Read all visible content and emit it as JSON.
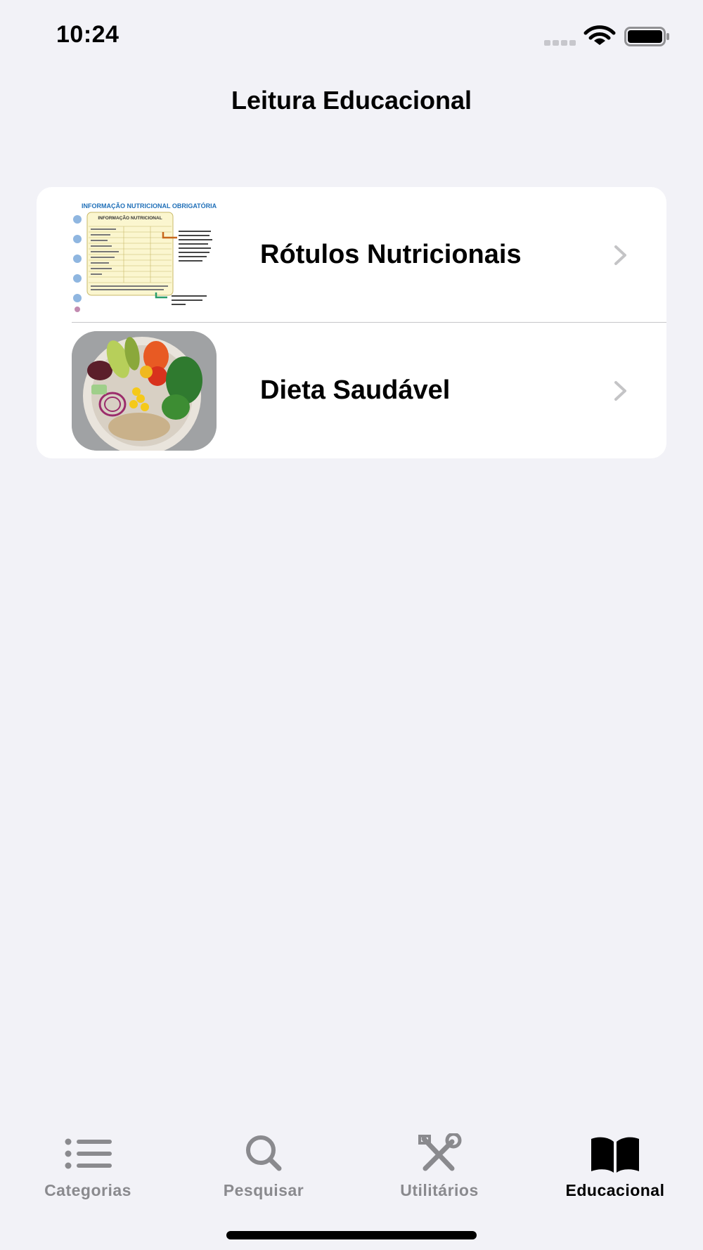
{
  "status_bar": {
    "time": "10:24"
  },
  "nav": {
    "title": "Leitura Educacional"
  },
  "list": {
    "items": [
      {
        "label": "Rótulos Nutricionais",
        "thumb_caption": "INFORMAÇÃO NUTRICIONAL OBRIGATÓRIA",
        "thumb_table_title": "INFORMAÇÃO NUTRICIONAL"
      },
      {
        "label": "Dieta Saudável"
      }
    ]
  },
  "tabs": [
    {
      "label": "Categorias",
      "icon": "list-icon",
      "active": false
    },
    {
      "label": "Pesquisar",
      "icon": "search-icon",
      "active": false
    },
    {
      "label": "Utilitários",
      "icon": "tools-icon",
      "active": false
    },
    {
      "label": "Educacional",
      "icon": "book-icon",
      "active": true
    }
  ],
  "colors": {
    "background": "#f2f2f7",
    "card": "#ffffff",
    "inactive_tab": "#8a8a8e",
    "active_tab": "#000000"
  }
}
